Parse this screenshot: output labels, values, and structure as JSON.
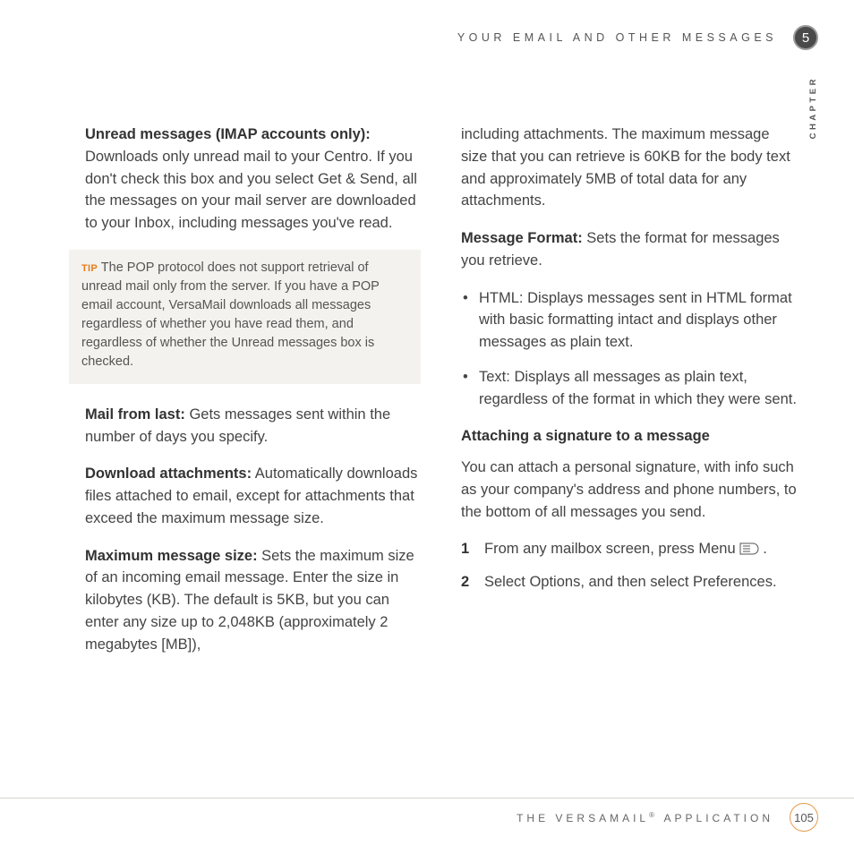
{
  "header": {
    "title": "YOUR EMAIL AND OTHER MESSAGES",
    "chapter_number": "5",
    "chapter_label": "CHAPTER"
  },
  "left": {
    "p1_label": "Unread messages (IMAP accounts only):",
    "p1_text": " Downloads only unread mail to your Centro. If you don't check this box and you select Get & Send, all the messages on your mail server are downloaded to your Inbox, including messages you've read.",
    "tip_label": "TIP",
    "tip_text": "  The POP protocol does not support retrieval of unread mail only from the server. If you have a POP email account, VersaMail downloads all messages regardless of whether you have read them, and regardless of whether the Unread messages box is checked.",
    "p2_label": "Mail from last:",
    "p2_text": " Gets messages sent within the number of days you specify.",
    "p3_label": "Download attachments:",
    "p3_text": " Automatically downloads files attached to email, except for attachments that exceed the maximum message size.",
    "p4_label": "Maximum message size:",
    "p4_text": " Sets the maximum size of an incoming email message. Enter the size in kilobytes (KB). The default is 5KB, but you can enter any size up to 2,048KB (approximately 2 megabytes [MB]),"
  },
  "right": {
    "p1_text": "including attachments. The maximum message size that you can retrieve is 60KB for the body text and approximately 5MB of total data for any attachments.",
    "p2_label": "Message Format:",
    "p2_text": " Sets the format for messages you retrieve.",
    "bullets": [
      {
        "label": "HTML:",
        "text": " Displays messages sent in HTML format with basic formatting intact and displays other messages as plain text."
      },
      {
        "label": "Text:",
        "text": " Displays all messages as plain text, regardless of the format in which they were sent."
      }
    ],
    "section_heading": "Attaching a signature to a message",
    "p3_text": "You can attach a personal signature, with info such as your company's address and phone numbers, to the bottom of all messages you send.",
    "steps": {
      "s1_pre": "From any mailbox screen, press ",
      "s1_bold": "Menu",
      "s1_post": " ",
      "s1_end": ".",
      "s2_pre": "Select ",
      "s2_bold1": "Options",
      "s2_mid": ", and then select ",
      "s2_bold2": "Preferences",
      "s2_end": "."
    }
  },
  "footer": {
    "title_pre": "THE VERSAMAIL",
    "title_sup": "®",
    "title_post": " APPLICATION",
    "page_number": "105"
  }
}
